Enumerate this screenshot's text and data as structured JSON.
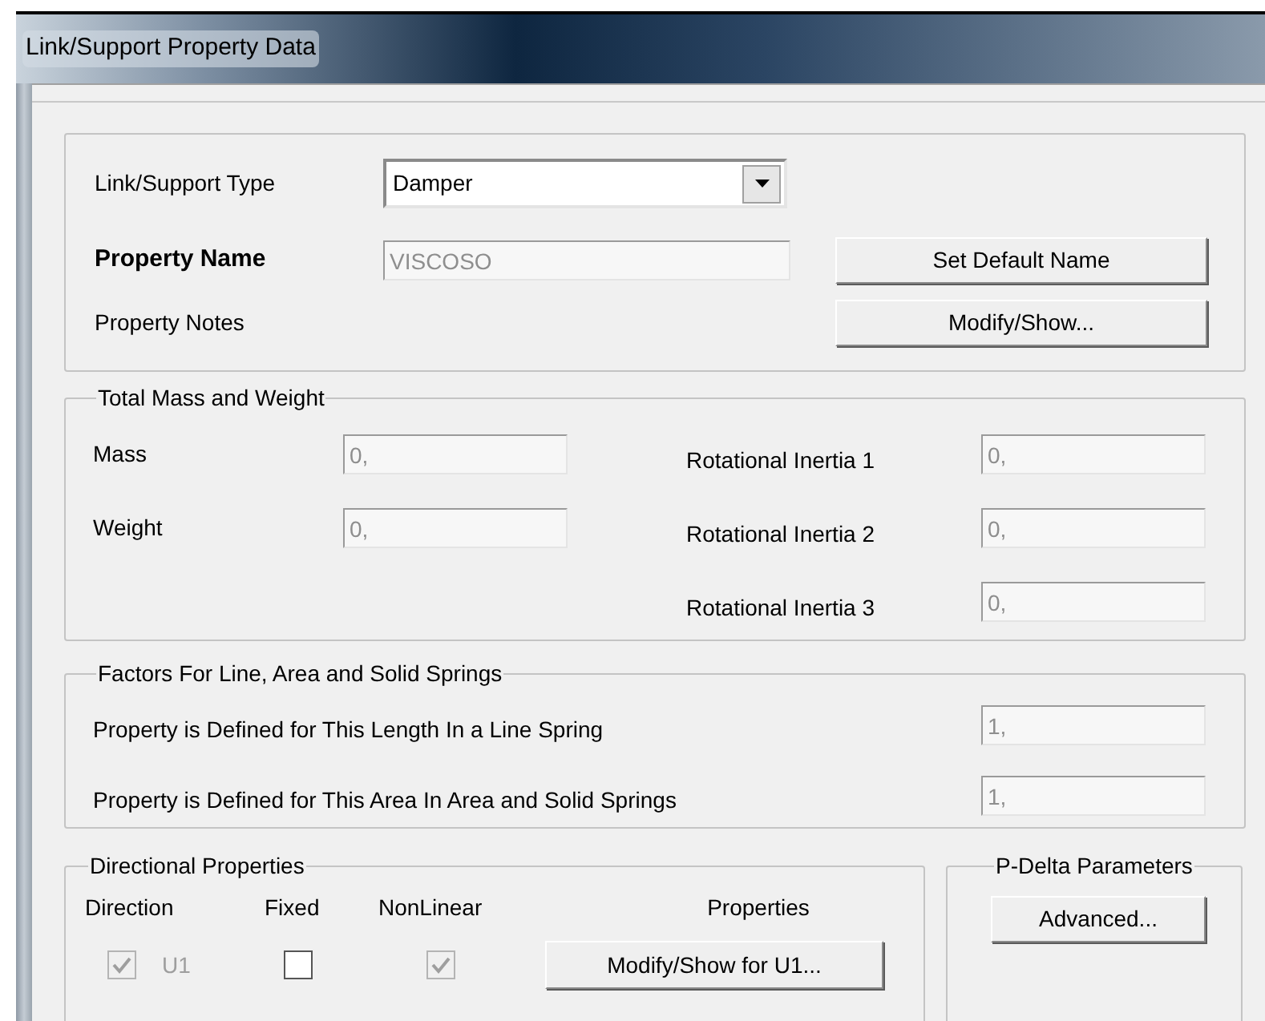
{
  "window": {
    "title": "Link/Support Property Data"
  },
  "general": {
    "type": {
      "label": "Link/Support Type",
      "value": "Damper"
    },
    "name": {
      "label": "Property Name",
      "value": "VISCOSO",
      "disabled": true
    },
    "set_default_button": "Set Default Name",
    "notes": {
      "label": "Property Notes",
      "button": "Modify/Show..."
    }
  },
  "mass": {
    "title": "Total Mass and Weight",
    "left_fields": [
      {
        "label": "Mass",
        "value": "0,",
        "disabled": true
      },
      {
        "label": "Weight",
        "value": "0,",
        "disabled": true
      }
    ],
    "right_fields": [
      {
        "label": "Rotational Inertia 1",
        "value": "0,",
        "disabled": true
      },
      {
        "label": "Rotational Inertia 2",
        "value": "0,",
        "disabled": true
      },
      {
        "label": "Rotational Inertia 3",
        "value": "0,",
        "disabled": true
      }
    ]
  },
  "factors": {
    "title": "Factors For Line, Area and Solid Springs",
    "rows": [
      {
        "label": "Property is Defined for This Length In a Line Spring",
        "value": "1,",
        "disabled": true
      },
      {
        "label": "Property is Defined for This Area In Area and Solid Springs",
        "value": "1,",
        "disabled": true
      }
    ]
  },
  "directional": {
    "title": "Directional Properties",
    "columns": [
      "Direction",
      "Fixed",
      "NonLinear",
      "Properties"
    ],
    "rows": [
      {
        "direction": {
          "label": "U1",
          "checked": true,
          "disabled": true
        },
        "fixed": {
          "checked": false,
          "disabled": false
        },
        "nonlinear": {
          "checked": true,
          "disabled": true
        },
        "button": "Modify/Show for U1..."
      }
    ]
  },
  "pdelta": {
    "title": "P-Delta Parameters",
    "button": "Advanced..."
  }
}
